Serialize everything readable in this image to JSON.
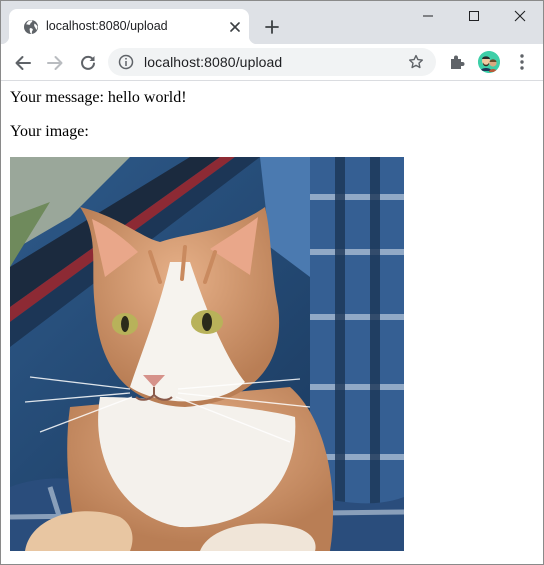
{
  "browser": {
    "tab": {
      "title": "localhost:8080/upload",
      "favicon_icon": "globe-icon"
    },
    "omnibox": {
      "url": "localhost:8080/upload"
    },
    "colors": {
      "frame": "#dee1e6",
      "omnibox_bg": "#f1f3f4",
      "icon": "#5f6368",
      "icon_disabled": "#b9bcc0",
      "profile_bg": "#3ecfa8"
    }
  },
  "page": {
    "message_line": "Your message: hello world!",
    "image_label": "Your image:",
    "image_description": "cat-photo"
  }
}
